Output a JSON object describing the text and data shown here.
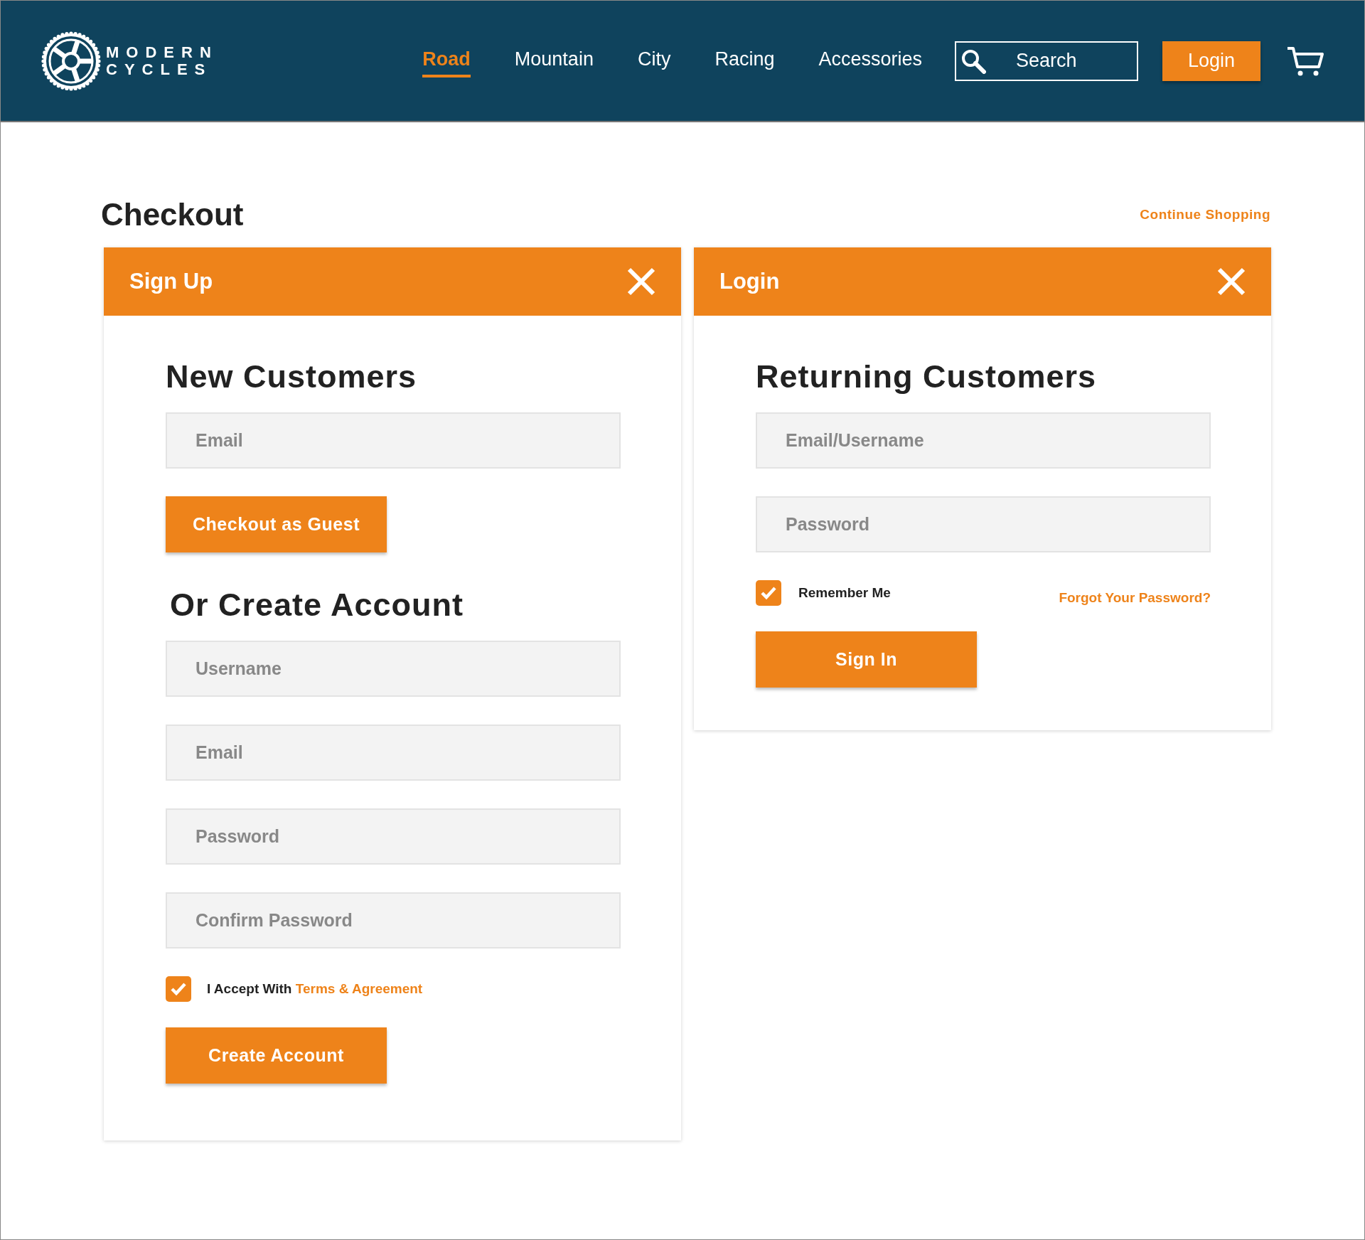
{
  "header": {
    "logo": [
      "MODERN",
      "CYCLES"
    ],
    "nav": [
      {
        "label": "Road",
        "selected": true
      },
      {
        "label": "Mountain",
        "selected": false
      },
      {
        "label": "City",
        "selected": false
      },
      {
        "label": "Racing",
        "selected": false
      },
      {
        "label": "Accessories",
        "selected": false
      }
    ],
    "search": {
      "placeholder": "Search"
    },
    "login_button": "Login"
  },
  "page": {
    "title": "Checkout",
    "continue_link": "Continue Shopping"
  },
  "signup": {
    "title": "Sign Up",
    "heading": "New Customers",
    "guest_fields": [
      {
        "placeholder": "Email"
      }
    ],
    "guest_button": "Checkout as Guest",
    "create_heading": "Or Create Account",
    "fields": [
      {
        "placeholder": "Username"
      },
      {
        "placeholder": "Email"
      },
      {
        "placeholder": "Password"
      },
      {
        "placeholder": "Confirm Password"
      }
    ],
    "terms": {
      "checked": true,
      "label": "I Accept With",
      "link": "Terms & Agreement"
    },
    "button": "Create Account"
  },
  "login": {
    "title": "Login",
    "heading": "Returning Customers",
    "fields": [
      {
        "placeholder": "Email/Username"
      },
      {
        "placeholder": "Password"
      }
    ],
    "remember": {
      "checked": true,
      "label": "Remember Me"
    },
    "forgot_link": "Forgot Your Password?",
    "button": "Sign In"
  }
}
